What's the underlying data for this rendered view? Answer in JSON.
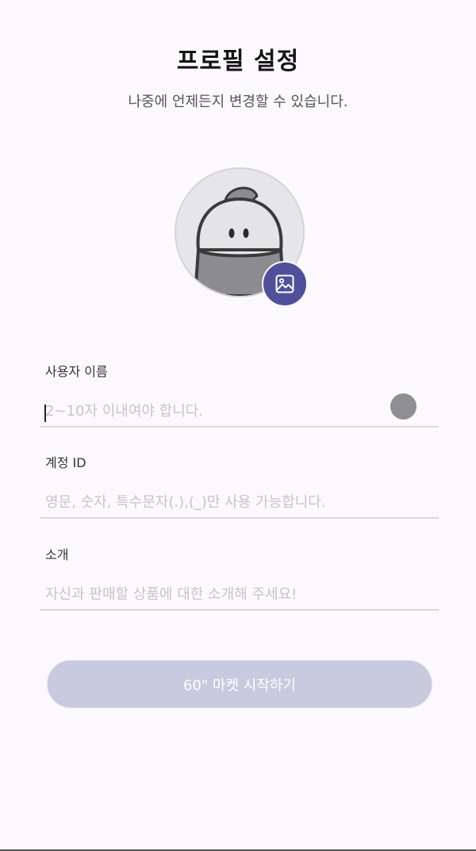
{
  "header": {
    "title": "프로필 설정",
    "subtitle": "나중에 언제든지 변경할 수 있습니다."
  },
  "avatar": {
    "icon": "default-character-avatar",
    "photo_button_icon": "image-icon",
    "accent_color": "#4f4f9a"
  },
  "form": {
    "username": {
      "label": "사용자 이름",
      "value": "",
      "placeholder": "2~10자 이내여야 합니다."
    },
    "account_id": {
      "label": "계정 ID",
      "value": "",
      "placeholder": "영문, 숫자, 특수문자(.),(_)만 사용 가능합니다."
    },
    "intro": {
      "label": "소개",
      "value": "",
      "placeholder": "자신과 판매할 상품에 대한 소개해 주세요!"
    }
  },
  "submit": {
    "label": "60\" 마켓 시작하기",
    "state": "disabled",
    "color": "#c9c9df"
  }
}
